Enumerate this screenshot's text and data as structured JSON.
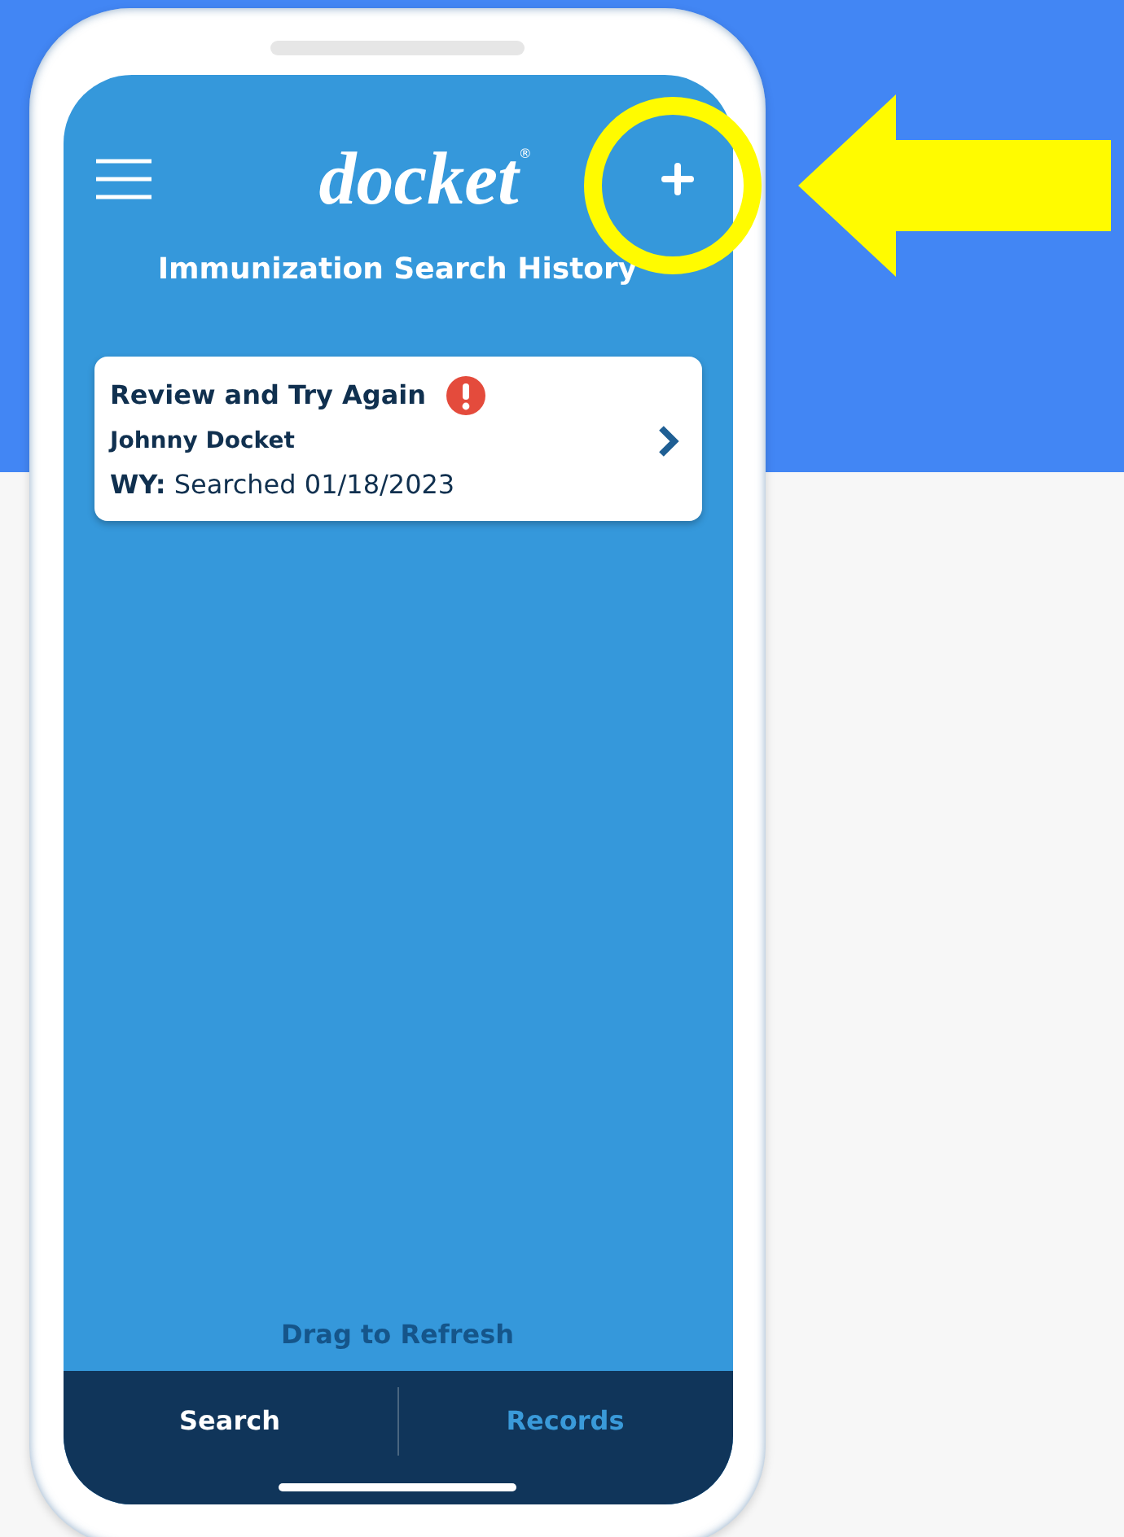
{
  "header": {
    "logo": "docket",
    "logo_mark": "®",
    "title": "Immunization Search History"
  },
  "searches": [
    {
      "status": "Review and Try Again",
      "alert": true,
      "person": "Johnny Docket",
      "detail": "**WY:** Searched 01/18/2023"
    }
  ],
  "refresh_hint": "Drag to Refresh",
  "tabs": [
    {
      "label": "Search",
      "selected": true
    },
    {
      "label": "Records",
      "selected": false
    }
  ]
}
